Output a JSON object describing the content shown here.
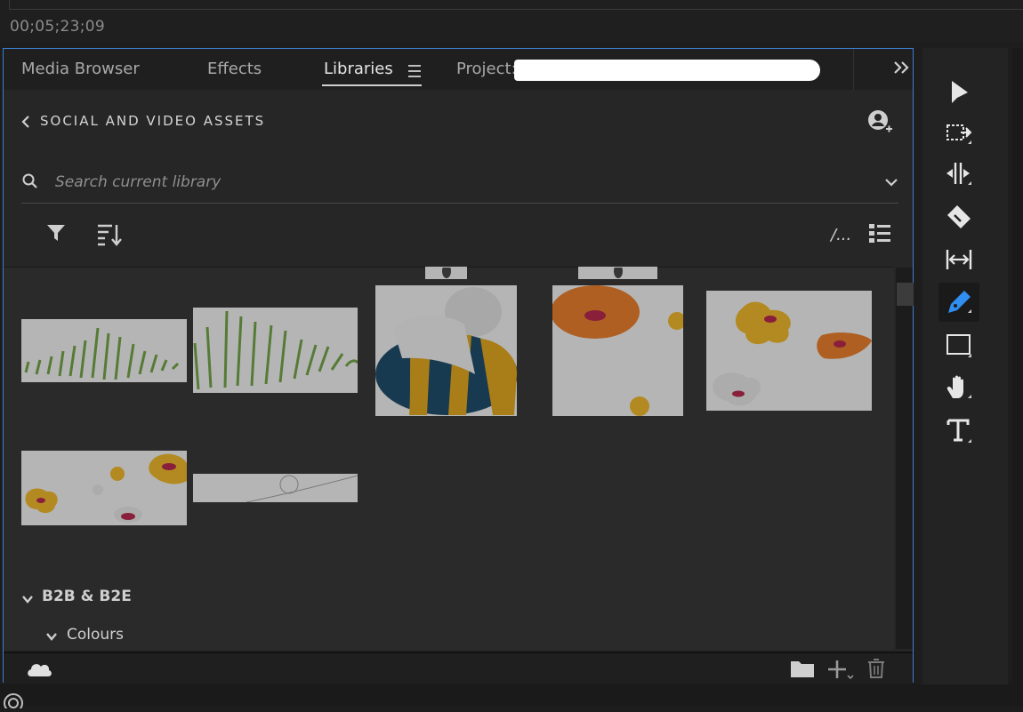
{
  "timecode": "00;05;23;09",
  "tabs": [
    {
      "label": "Media Browser",
      "active": false
    },
    {
      "label": "Effects",
      "active": false
    },
    {
      "label": "Libraries",
      "active": true
    },
    {
      "label": "Project:",
      "active": false
    }
  ],
  "library": {
    "name": "SOCIAL AND VIDEO ASSETS",
    "search_placeholder": "Search current library",
    "view_more": "/..."
  },
  "sections": [
    {
      "label": "B2B & B2E"
    },
    {
      "label": "Colours"
    }
  ],
  "tools": [
    "selection-tool",
    "track-select-tool",
    "ripple-edit-tool",
    "razor-tool",
    "slip-tool",
    "pen-tool",
    "rectangle-tool",
    "hand-tool",
    "type-tool"
  ],
  "active_tool": "pen-tool",
  "colors": {
    "accent": "#3e7fd0",
    "panel_bg": "#262626",
    "grid_bg": "#2a2a2a",
    "pen_blue": "#2f8ef0"
  }
}
